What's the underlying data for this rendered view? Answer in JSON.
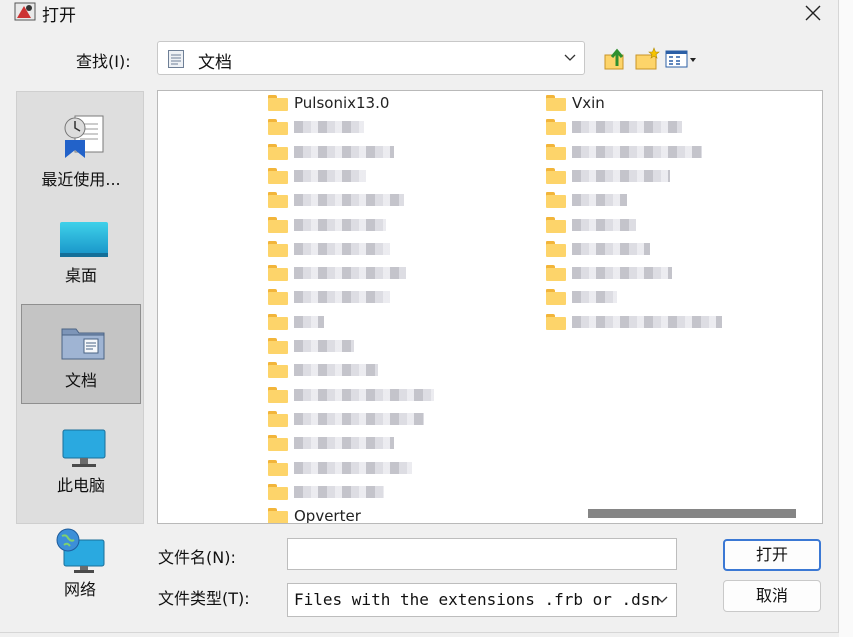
{
  "window": {
    "title": "打开",
    "close": "×"
  },
  "lookin": {
    "label": "查找(I):",
    "value": "文档"
  },
  "toolbar": [
    "up-folder-icon",
    "new-folder-icon",
    "view-menu-icon"
  ],
  "places": [
    {
      "label": "最近使用...",
      "icon": "recent-icon"
    },
    {
      "label": "桌面",
      "icon": "desktop-icon"
    },
    {
      "label": "文档",
      "icon": "documents-icon",
      "selected": true
    },
    {
      "label": "此电脑",
      "icon": "computer-icon"
    },
    {
      "label": "网络",
      "icon": "network-icon"
    }
  ],
  "files": {
    "left_column": [
      "Pulsonix13.0",
      "",
      "",
      "",
      "",
      "",
      "",
      "",
      "",
      "",
      "",
      "",
      "",
      "",
      "",
      "",
      "",
      "Opverter"
    ],
    "right_column": [
      "Vxin",
      "",
      "",
      "",
      "",
      "",
      "",
      "",
      "",
      ""
    ]
  },
  "filename": {
    "label": "文件名(N):",
    "value": ""
  },
  "filetype": {
    "label": "文件类型(T):",
    "value": "Files with the extensions .frb or .dsn"
  },
  "buttons": {
    "open": "打开",
    "cancel": "取消"
  },
  "colors": {
    "accent": "#3b78d4",
    "folder": "#fdd46a"
  }
}
